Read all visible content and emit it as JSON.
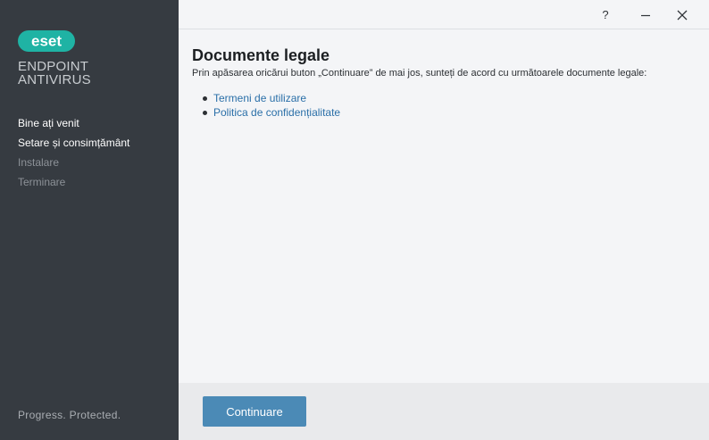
{
  "brand": {
    "logo_text": "eset",
    "logo_color": "#1fb3a4",
    "product_line1": "ENDPOINT",
    "product_line2": "ANTIVIRUS",
    "tagline": "Progress. Protected."
  },
  "sidebar": {
    "steps": [
      {
        "label": "Bine ați venit",
        "state": "active"
      },
      {
        "label": "Setare și consimțământ",
        "state": "active"
      },
      {
        "label": "Instalare",
        "state": "inactive"
      },
      {
        "label": "Terminare",
        "state": "inactive"
      }
    ]
  },
  "titlebar": {
    "help": "?",
    "minimize_icon": "minimize-icon",
    "close_icon": "close-icon"
  },
  "main": {
    "heading": "Documente legale",
    "subtitle": "Prin apăsarea oricărui buton „Continuare” de mai jos, sunteți de acord cu următoarele documente legale:",
    "links": [
      {
        "label": "Termeni de utilizare"
      },
      {
        "label": "Politica de confidențialitate"
      }
    ]
  },
  "footer": {
    "continue_label": "Continuare"
  },
  "colors": {
    "sidebar_bg": "#363b41",
    "link": "#2a6fa8",
    "button": "#4b8ab6"
  }
}
